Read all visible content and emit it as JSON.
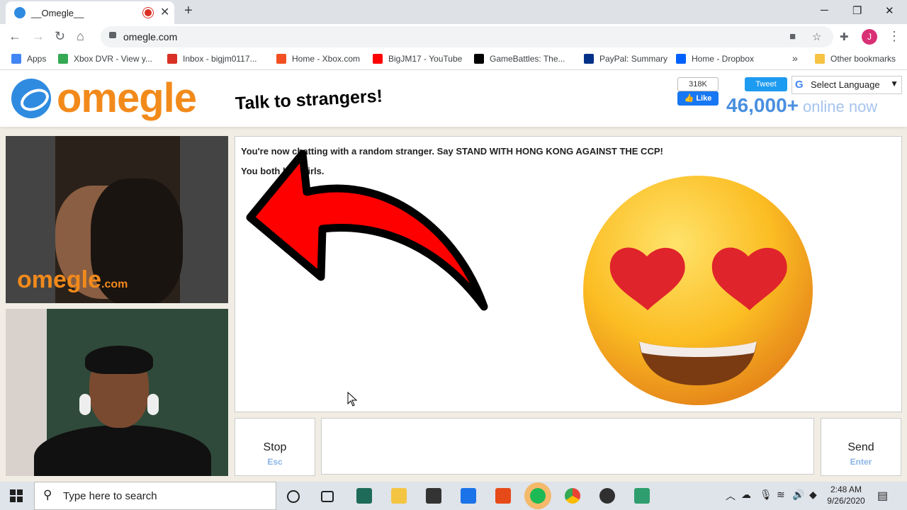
{
  "browser": {
    "tab_title": "__Omegle__",
    "tab_close": "✕",
    "new_tab": "+",
    "url": "omegle.com",
    "window_controls": {
      "minimize": "─",
      "restore": "❐",
      "close": "✕"
    },
    "profile_initial": "J"
  },
  "bookmarks": [
    {
      "label": "Apps",
      "icon": "apps-grid-icon",
      "color": "#4285f4"
    },
    {
      "label": "Xbox DVR - View y...",
      "icon": "xbox-dvr-icon",
      "color": "#34a853"
    },
    {
      "label": "Inbox - bigjm0117...",
      "icon": "gmail-icon",
      "color": "#d93025"
    },
    {
      "label": "Home - Xbox.com",
      "icon": "microsoft-icon",
      "color": "#f25022"
    },
    {
      "label": "BigJM17 - YouTube",
      "icon": "youtube-icon",
      "color": "#ff0000"
    },
    {
      "label": "GameBattles: The...",
      "icon": "gamebattles-icon",
      "color": "#000000"
    },
    {
      "label": "PayPal: Summary",
      "icon": "paypal-icon",
      "color": "#003087"
    },
    {
      "label": "Home - Dropbox",
      "icon": "dropbox-icon",
      "color": "#0061ff"
    },
    {
      "label": "Other bookmarks",
      "icon": "folder-icon",
      "color": "#f6c342"
    }
  ],
  "bookmarks_overflow": "»",
  "header": {
    "logo_text": "omegle",
    "tagline": "Talk to strangers!",
    "fb_count": "318K",
    "fb_like": "👍 Like",
    "tweet": "Tweet",
    "select_language": "Select Language",
    "online_count": "46,000+",
    "online_label": "online now"
  },
  "video": {
    "watermark": "omegle",
    "watermark_com": ".com"
  },
  "chat": {
    "messages": [
      "You're now chatting with a random stranger. Say STAND WITH HONG KONG AGAINST THE CCP!",
      "You both like Girls."
    ]
  },
  "controls": {
    "stop_label": "Stop",
    "stop_key": "Esc",
    "send_label": "Send",
    "send_key": "Enter"
  },
  "taskbar": {
    "search_placeholder": "Type here to search",
    "time": "2:48 AM",
    "date": "9/26/2020",
    "apps": [
      {
        "icon": "cortana-icon",
        "color": "#222222"
      },
      {
        "icon": "task-view-icon",
        "color": "#222222"
      },
      {
        "icon": "filmora-icon",
        "color": "#1e6b5a"
      },
      {
        "icon": "file-explorer-icon",
        "color": "#f4c542"
      },
      {
        "icon": "store-icon",
        "color": "#333333"
      },
      {
        "icon": "mail-icon",
        "color": "#1a73e8"
      },
      {
        "icon": "office-icon",
        "color": "#e64a19"
      },
      {
        "icon": "spotify-icon",
        "color": "#1db954"
      },
      {
        "icon": "chrome-icon",
        "color": "#4285f4"
      },
      {
        "icon": "obs-icon",
        "color": "#303030"
      },
      {
        "icon": "game-app-icon",
        "color": "#2e9e6e"
      }
    ]
  },
  "colors": {
    "omegle_orange": "#f28a1b",
    "omegle_blue": "#4a8fe0",
    "arrow_red": "#ff0000"
  }
}
